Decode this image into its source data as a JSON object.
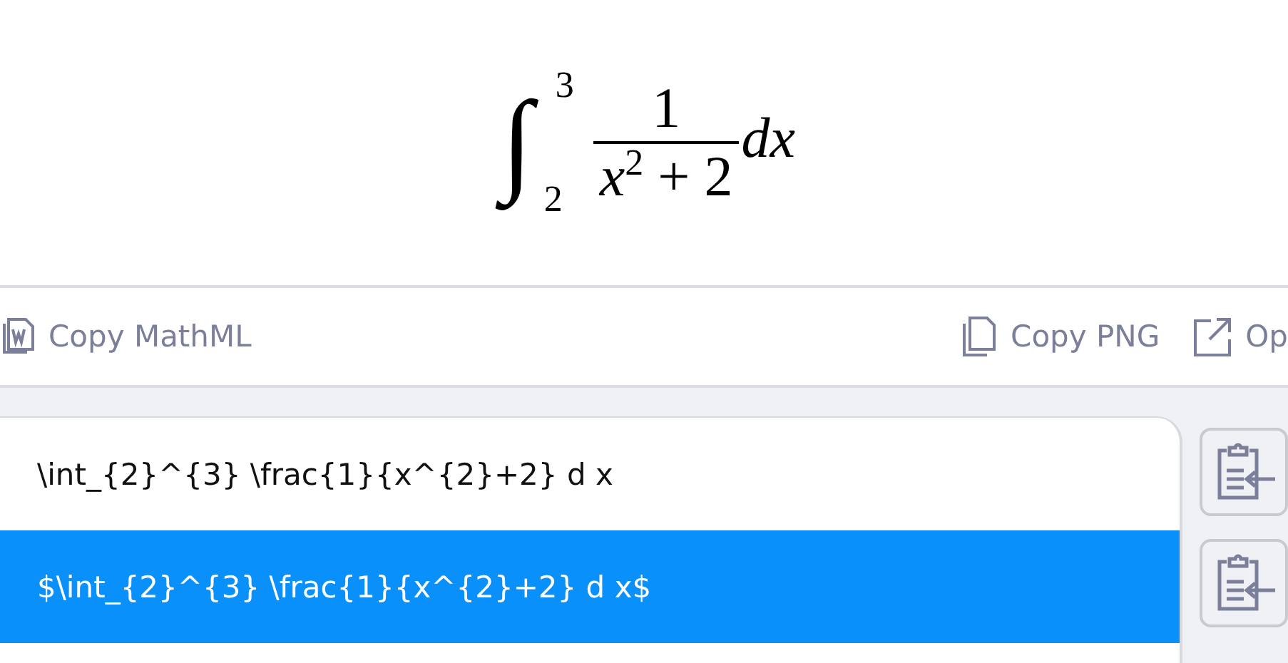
{
  "formula": {
    "integral_sign": "∫",
    "upper_limit": "3",
    "lower_limit": "2",
    "numerator": "1",
    "denominator": "x$^{2}$ + 2",
    "differential": "dx"
  },
  "toolbar": [
    {
      "kind": "word",
      "label": "Copy MathML"
    },
    {
      "kind": "copy",
      "label": "Copy PNG"
    },
    {
      "kind": "open",
      "label": "Op"
    }
  ],
  "results": [
    {
      "text": "\\int_{2}^{3} \\frac{1}{x^{2}+2} d x",
      "selected": false
    },
    {
      "text": "$\\int_{2}^{3} \\frac{1}{x^{2}+2} d x$",
      "selected": true
    }
  ]
}
